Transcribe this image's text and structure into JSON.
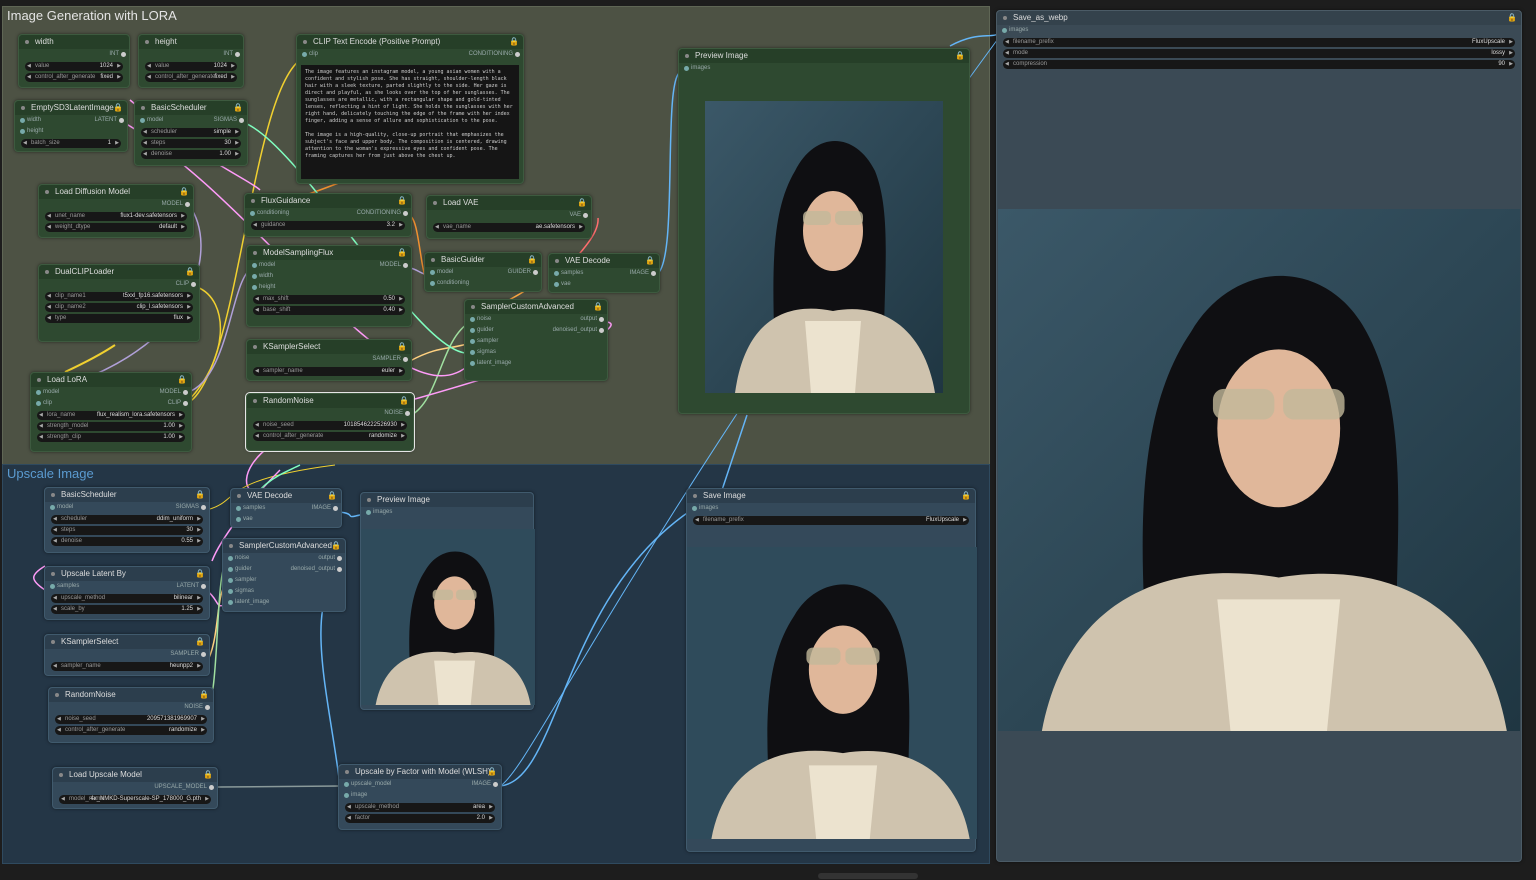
{
  "groups": {
    "g1": "Image Generation with LORA",
    "g2": "Upscale Image"
  },
  "nodes": {
    "width": {
      "title": "width",
      "out": "INT",
      "w": [
        [
          "value",
          "1024"
        ],
        [
          "control_after_generate",
          "fixed"
        ]
      ]
    },
    "height": {
      "title": "height",
      "out": "INT",
      "w": [
        [
          "value",
          "1024"
        ],
        [
          "control_after_generate",
          "fixed"
        ]
      ]
    },
    "latent": {
      "title": "EmptySD3LatentImage",
      "in": [
        "width",
        "height"
      ],
      "out": "LATENT",
      "w": [
        [
          "batch_size",
          "1"
        ]
      ]
    },
    "sched1": {
      "title": "BasicScheduler",
      "in": [
        "model"
      ],
      "out": "SIGMAS",
      "w": [
        [
          "scheduler",
          "simple"
        ],
        [
          "steps",
          "30"
        ],
        [
          "denoise",
          "1.00"
        ]
      ]
    },
    "clip": {
      "title": "CLIP Text Encode (Positive Prompt)",
      "in": [
        "clip"
      ],
      "out": "CONDITIONING",
      "text": "The image features an instagram model, a young asian women with a confident and stylish pose. She has straight, shoulder-length black hair with a sleek texture, parted slightly to the side. Her gaze is direct and playful, as she looks over the top of her sunglasses. The sunglasses are metallic, with a rectangular shape and gold-tinted lenses, reflecting a hint of light. She holds the sunglasses with her right hand, delicately touching the edge of the frame with her index finger, adding a sense of allure and sophistication to the pose.\n\nThe image is a high-quality, close-up portrait that emphasizes the subject's face and upper body. The composition is centered, drawing attention to the woman's expressive eyes and confident pose. The framing captures her from just above the chest up."
    },
    "diff": {
      "title": "Load Diffusion Model",
      "out": "MODEL",
      "w": [
        [
          "unet_name",
          "flux1-dev.safetensors"
        ],
        [
          "weight_dtype",
          "default"
        ]
      ]
    },
    "flux": {
      "title": "FluxGuidance",
      "in": [
        "conditioning"
      ],
      "out": "CONDITIONING",
      "w": [
        [
          "guidance",
          "3.2"
        ]
      ]
    },
    "vae": {
      "title": "Load VAE",
      "out": "VAE",
      "w": [
        [
          "vae_name",
          "ae.safetensors"
        ]
      ]
    },
    "dual": {
      "title": "DualCLIPLoader",
      "out": "CLIP",
      "w": [
        [
          "clip_name1",
          "t5xxl_fp16.safetensors"
        ],
        [
          "clip_name2",
          "clip_l.safetensors"
        ],
        [
          "type",
          "flux"
        ]
      ]
    },
    "msf": {
      "title": "ModelSamplingFlux",
      "in": [
        "model",
        "width",
        "height"
      ],
      "out": "MODEL",
      "w": [
        [
          "max_shift",
          "0.50"
        ],
        [
          "base_shift",
          "0.40"
        ]
      ]
    },
    "guider": {
      "title": "BasicGuider",
      "in": [
        "model",
        "conditioning"
      ],
      "out": "GUIDER"
    },
    "vaedec": {
      "title": "VAE Decode",
      "in": [
        "samples",
        "vae"
      ],
      "out": "IMAGE"
    },
    "sca": {
      "title": "SamplerCustomAdvanced",
      "in": [
        "noise",
        "guider",
        "sampler",
        "sigmas",
        "latent_image"
      ],
      "outs": [
        "output",
        "denoised_output"
      ]
    },
    "ksel": {
      "title": "KSamplerSelect",
      "out": "SAMPLER",
      "w": [
        [
          "sampler_name",
          "euler"
        ]
      ]
    },
    "lora": {
      "title": "Load LoRA",
      "in": [
        "model",
        "clip"
      ],
      "outs": [
        "MODEL",
        "CLIP"
      ],
      "w": [
        [
          "lora_name",
          "flux_realism_lora.safetensors"
        ],
        [
          "strength_model",
          "1.00"
        ],
        [
          "strength_clip",
          "1.00"
        ]
      ]
    },
    "noise": {
      "title": "RandomNoise",
      "out": "NOISE",
      "w": [
        [
          "noise_seed",
          "1018546222526930"
        ],
        [
          "control_after_generate",
          "randomize"
        ]
      ]
    },
    "prev1": {
      "title": "Preview Image",
      "in": [
        "images"
      ]
    },
    "save": {
      "title": "Save_as_webp",
      "in": [
        "images"
      ],
      "w": [
        [
          "filename_prefix",
          "FluxUpscale"
        ],
        [
          "mode",
          "lossy"
        ],
        [
          "compression",
          "90"
        ]
      ]
    },
    "sched2": {
      "title": "BasicScheduler",
      "in": [
        "model"
      ],
      "out": "SIGMAS",
      "w": [
        [
          "scheduler",
          "ddim_uniform"
        ],
        [
          "steps",
          "30"
        ],
        [
          "denoise",
          "0.55"
        ]
      ]
    },
    "vaedec2": {
      "title": "VAE Decode",
      "in": [
        "samples",
        "vae"
      ],
      "out": "IMAGE"
    },
    "prev2": {
      "title": "Preview Image",
      "in": [
        "images"
      ]
    },
    "save2": {
      "title": "Save Image",
      "in": [
        "images"
      ],
      "w": [
        [
          "filename_prefix",
          "FluxUpscale"
        ]
      ]
    },
    "sca2": {
      "title": "SamplerCustomAdvanced",
      "in": [
        "noise",
        "guider",
        "sampler",
        "sigmas",
        "latent_image"
      ],
      "outs": [
        "output",
        "denoised_output"
      ]
    },
    "upl": {
      "title": "Upscale Latent By",
      "in": [
        "samples"
      ],
      "out": "LATENT",
      "w": [
        [
          "upscale_method",
          "bilinear"
        ],
        [
          "scale_by",
          "1.25"
        ]
      ]
    },
    "ksel2": {
      "title": "KSamplerSelect",
      "out": "SAMPLER",
      "w": [
        [
          "sampler_name",
          "heunpp2"
        ]
      ]
    },
    "noise2": {
      "title": "RandomNoise",
      "out": "NOISE",
      "w": [
        [
          "noise_seed",
          "209571381969907"
        ],
        [
          "control_after_generate",
          "randomize"
        ]
      ]
    },
    "lum": {
      "title": "Load Upscale Model",
      "out": "UPSCALE_MODEL",
      "w": [
        [
          "model_name",
          "4x_NMKD-Superscale-SP_178000_G.pth"
        ]
      ]
    },
    "ubf": {
      "title": "Upscale by Factor with Model (WLSH)",
      "in": [
        "upscale_model",
        "image"
      ],
      "out": "IMAGE",
      "w": [
        [
          "upscale_method",
          "area"
        ],
        [
          "factor",
          "2.0"
        ]
      ]
    }
  },
  "colors": {
    "green_node": "#2e4930",
    "blue_node": "#34495a",
    "wire_clip": "#f0d030",
    "wire_model": "#b0a0d8",
    "wire_cond": "#f09030",
    "wire_image": "#64b5f6",
    "wire_latent": "#ff9cf9",
    "wire_vae": "#ff6e6e",
    "wire_sampler": "#ffd180"
  }
}
